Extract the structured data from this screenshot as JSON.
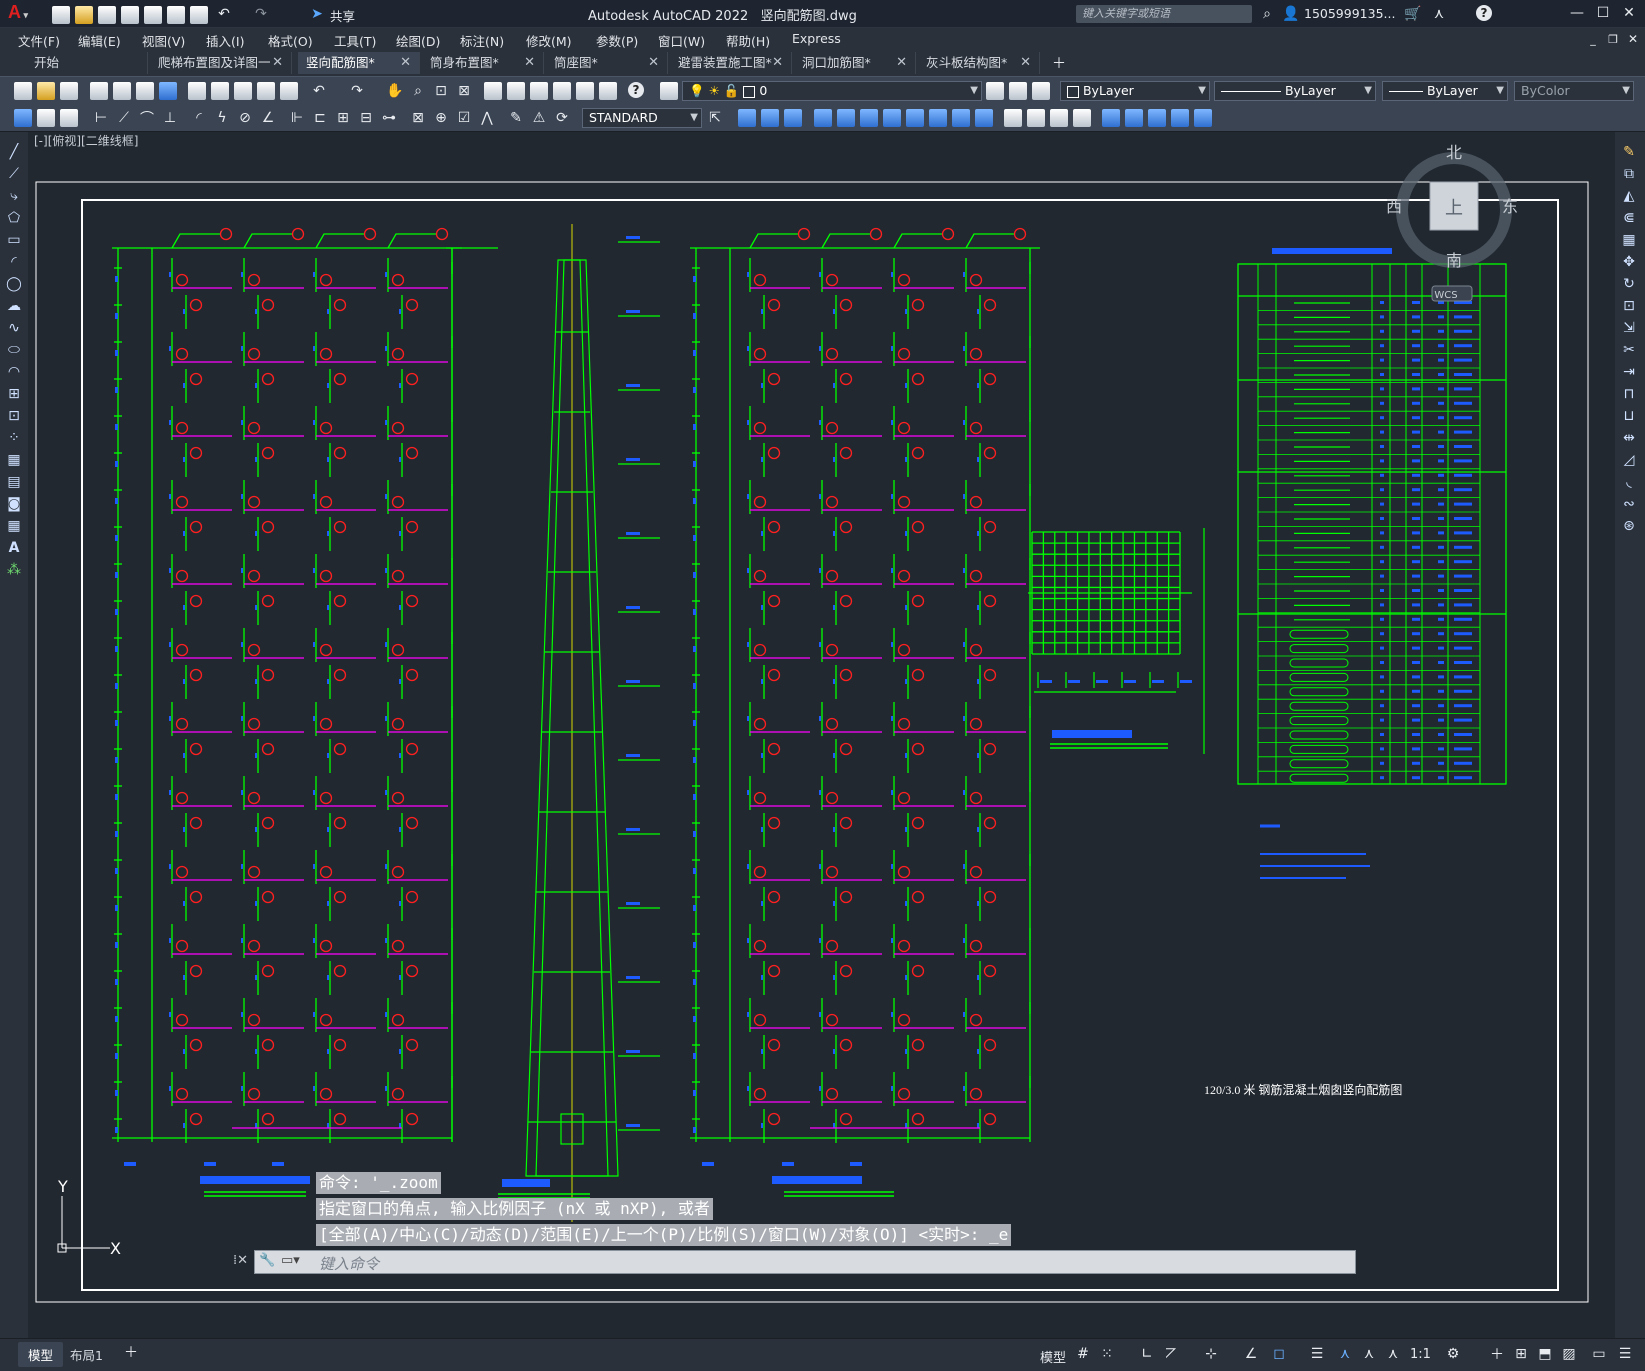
{
  "title": {
    "app": "Autodesk AutoCAD 2022",
    "filename": "竖向配筋图.dwg",
    "share": "共享",
    "search_placeholder": "键入关键字或短语",
    "user": "1505999135...",
    "logo": "A"
  },
  "menu": [
    "文件(F)",
    "编辑(E)",
    "视图(V)",
    "插入(I)",
    "格式(O)",
    "工具(T)",
    "绘图(D)",
    "标注(N)",
    "修改(M)",
    "参数(P)",
    "窗口(W)",
    "帮助(H)",
    "Express"
  ],
  "tabs": [
    {
      "label": "开始",
      "closable": false
    },
    {
      "label": "爬梯布置图及详图一",
      "closable": true
    },
    {
      "label": "竖向配筋图*",
      "closable": true,
      "active": true
    },
    {
      "label": "筒身布置图*",
      "closable": true
    },
    {
      "label": "筒座图*",
      "closable": true
    },
    {
      "label": "避雷装置施工图*",
      "closable": true
    },
    {
      "label": "洞口加筋图*",
      "closable": true
    },
    {
      "label": "灰斗板结构图*",
      "closable": true
    }
  ],
  "toolbar": {
    "layer_value": "0",
    "color": "ByLayer",
    "linetype": "ByLayer",
    "lineweight": "ByLayer",
    "plotstyle": "ByColor",
    "textstyle": "STANDARD"
  },
  "viewport": {
    "view_label": "[-][俯视][二维线框]",
    "viewcube": {
      "north": "北",
      "south": "南",
      "east": "东",
      "west": "西",
      "top": "上",
      "wcs": "WCS"
    },
    "ucs": {
      "y": "Y",
      "x": "X"
    },
    "drawing_title": "120/3.0 米 钢筋混凝土烟囱竖向配筋图"
  },
  "command": {
    "history": [
      "命令: '_.zoom",
      "指定窗口的角点, 输入比例因子 (nX 或 nXP), 或者",
      "[全部(A)/中心(C)/动态(D)/范围(E)/上一个(P)/比例(S)/窗口(W)/对象(O)] <实时>: _e"
    ],
    "placeholder": "键入命令"
  },
  "status": {
    "layout_tabs": [
      "模型",
      "布局1"
    ],
    "model_button": "模型",
    "scale": "1:1"
  },
  "colors": {
    "accent_green": "#00ff00",
    "red": "#ff2020",
    "magenta": "#ff00ff",
    "blue": "#1e5bff",
    "yellow": "#e8e800"
  }
}
